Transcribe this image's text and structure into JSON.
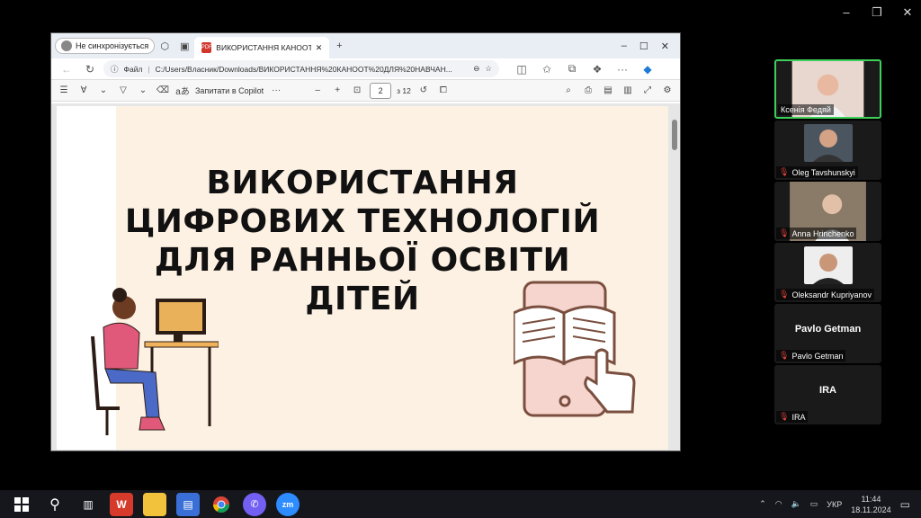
{
  "zoom_window": {
    "minimize": "–",
    "restore": "❐",
    "close": "✕"
  },
  "edge": {
    "profile_label": "Не синхронізується",
    "tab_title": "ВИКОРИСТАННЯ КАНООТ ДЛЯ ⟩",
    "tab_close": "✕",
    "new_tab": "+",
    "window_controls": {
      "minimize": "–",
      "maximize": "☐",
      "close": "✕"
    },
    "url_prefix": "Файл",
    "url_path": "C:/Users/Власник/Downloads/ВИКОРИСТАННЯ%20КАНООТ%20ДЛЯ%20НАВЧАН...",
    "pdf_toolbar": {
      "ask_copilot": "Запитати в Copilot",
      "more": "···",
      "zoom_out": "–",
      "zoom_in": "+",
      "current_page": "2",
      "page_count": "з 12"
    }
  },
  "slide": {
    "title_lines": [
      "ВИКОРИСТАННЯ",
      "ЦИФРОВИХ ТЕХНОЛОГІЙ",
      "ДЛЯ РАННЬОЇ ОСВІТИ",
      "ДІТЕЙ"
    ]
  },
  "participants": [
    {
      "name": "Ксенія Федяй",
      "muted": false
    },
    {
      "name": "Oleg Tavshunskyi",
      "muted": true
    },
    {
      "name": "Anna Hrinchenko",
      "muted": true
    },
    {
      "name": "Oleksandr Kupriyanov",
      "muted": true
    },
    {
      "name": "Pavlo Getman",
      "display": "Pavlo Getman",
      "muted": true
    },
    {
      "name": "IRA",
      "display": "IRA",
      "muted": true
    }
  ],
  "taskbar": {
    "language": "УКР",
    "time": "11:44",
    "date": "18.11.2024"
  }
}
